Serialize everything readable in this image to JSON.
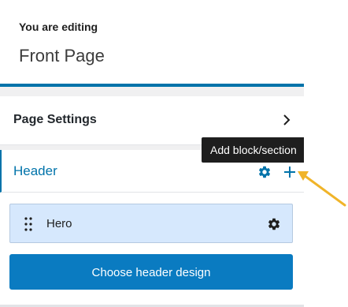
{
  "editing": {
    "label": "You are editing",
    "page_name": "Front Page"
  },
  "page_settings": {
    "label": "Page Settings",
    "icon": "chevron-right-icon"
  },
  "header_section": {
    "label": "Header",
    "settings_icon": "gear-icon",
    "add_icon": "plus-icon",
    "accent_color": "#0073aa"
  },
  "tooltip": {
    "text": "Add block/section"
  },
  "blocks": [
    {
      "label": "Hero",
      "drag_icon": "drag-handle-icon",
      "settings_icon": "gear-icon"
    }
  ],
  "choose_button": {
    "label": "Choose header design",
    "color": "#0a7bc1"
  },
  "annotation": {
    "icon": "arrow-icon",
    "color": "#f0b429"
  }
}
